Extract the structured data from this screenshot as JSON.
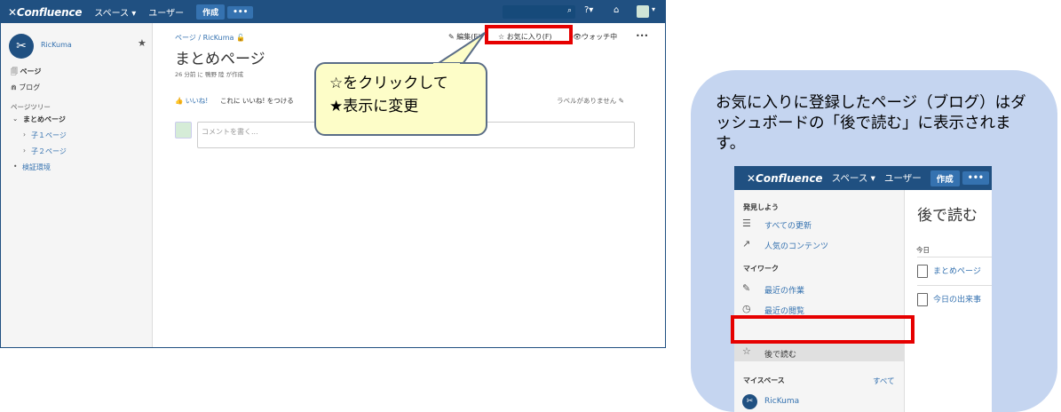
{
  "shot1": {
    "topbar": {
      "logo": "✕Confluence",
      "spaces": "スペース ▾",
      "people": "ユーザー",
      "create": "作成",
      "more": "•••",
      "search_icon": "⌕",
      "help": "?▾",
      "notify": "⌂"
    },
    "sidebar": {
      "space_name": "RicKuma",
      "star": "★",
      "pages": "ページ",
      "blog": "ブログ",
      "tree_label": "ページツリー",
      "tree": [
        {
          "label": "まとめページ",
          "bold": true
        },
        {
          "label": "子１ページ",
          "bold": false
        },
        {
          "label": "子２ページ",
          "bold": false
        },
        {
          "label": "検証環境",
          "bold": false
        }
      ]
    },
    "main": {
      "breadcrumb": "ページ / RicKuma",
      "title": "まとめページ",
      "byline": "26 分前 に 鴨野 陸 が作成",
      "edit": "✎ 編集(E)",
      "favorite": "☆ お気に入り(F)",
      "watch": "👁ウォッチ中",
      "more": "•••",
      "like": "👍 いいね!",
      "like_msg": "これに いいね! をつける",
      "labels": "ラベルがありません ✎",
      "comment_placeholder": "コメントを書く..."
    },
    "callout": {
      "line1": "☆をクリックして",
      "line2": "★表示に変更"
    }
  },
  "panel": {
    "text": "お気に入りに登録したページ（ブログ）はダッシュボードの「後で読む」に表示されます。"
  },
  "shot2": {
    "topbar": {
      "logo": "✕Confluence",
      "spaces": "スペース ▾",
      "people": "ユーザー",
      "create": "作成",
      "more": "•••"
    },
    "sidebar": {
      "discover": "発見しよう",
      "all_updates": "すべての更新",
      "popular": "人気のコンテンツ",
      "mywork": "マイワーク",
      "recent_work": "最近の作業",
      "recent_view": "最近の閲覧",
      "read_later": "後で読む",
      "my_spaces": "マイスペース",
      "all": "すべて",
      "space": "RicKuma"
    },
    "main": {
      "title": "後で読む",
      "today": "今日",
      "items": [
        "まとめページ",
        "今日の出来事"
      ]
    }
  }
}
